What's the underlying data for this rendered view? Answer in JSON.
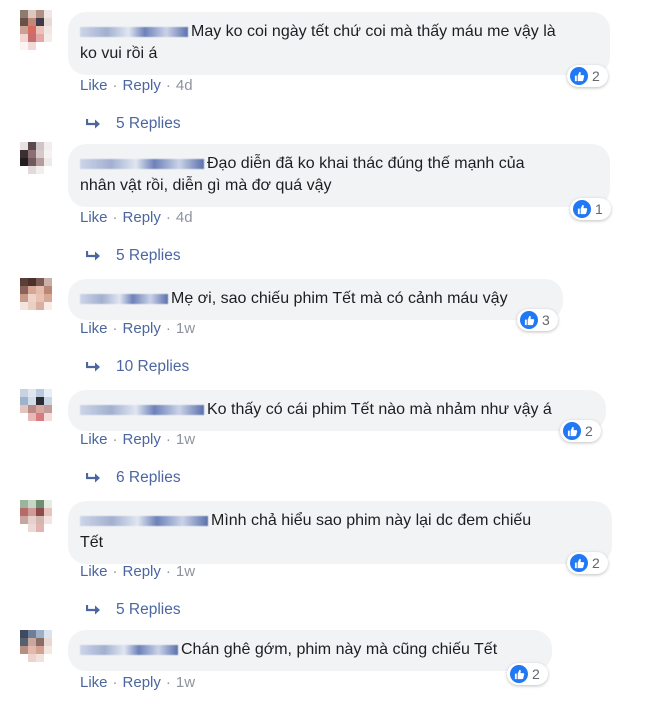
{
  "comments": [
    {
      "text": "May ko coi ngày tết chứ coi mà thấy máu me vậy là ko vui rồi á",
      "text_line1": "May ko coi ngày tết chứ coi mà thấy máu me vậy là",
      "text_line2": "ko vui rồi á",
      "reactions": "2",
      "like": "Like",
      "reply": "Reply",
      "time": "4d",
      "replies": "5 Replies"
    },
    {
      "text_line1": "Đạo diễn đã ko khai thác đúng thế mạnh của",
      "text_line2": "nhân vật rồi, diễn gì mà đơ quá vậy",
      "reactions": "1",
      "like": "Like",
      "reply": "Reply",
      "time": "4d",
      "replies": "5 Replies"
    },
    {
      "text_line1": "Mẹ ơi, sao chiếu phim Tết mà có cảnh máu vậy",
      "text_line2": "",
      "reactions": "3",
      "like": "Like",
      "reply": "Reply",
      "time": "1w",
      "replies": "10 Replies"
    },
    {
      "text_line1": "Ko thấy có cái phim Tết nào mà nhảm như vậy á",
      "text_line2": "",
      "reactions": "2",
      "like": "Like",
      "reply": "Reply",
      "time": "1w",
      "replies": "6 Replies"
    },
    {
      "text_line1": "Mình chả hiểu sao phim này lại dc đem chiếu",
      "text_line2": "Tết",
      "reactions": "2",
      "like": "Like",
      "reply": "Reply",
      "time": "1w",
      "replies": "5 Replies"
    },
    {
      "text_line1": "Chán ghê gớm, phim này mà cũng chiếu Tết",
      "text_line2": "",
      "reactions": "2",
      "like": "Like",
      "reply": "Reply",
      "time": "1w",
      "replies": ""
    }
  ],
  "separator": "·",
  "colors": {
    "bubble": "#f2f3f5",
    "link": "#4b66a0",
    "meta": "#8d949e",
    "like_badge": "#2078f4"
  },
  "icons": {
    "like": "thumbs-up-icon",
    "reply_arrow": "reply-arrow-icon"
  }
}
